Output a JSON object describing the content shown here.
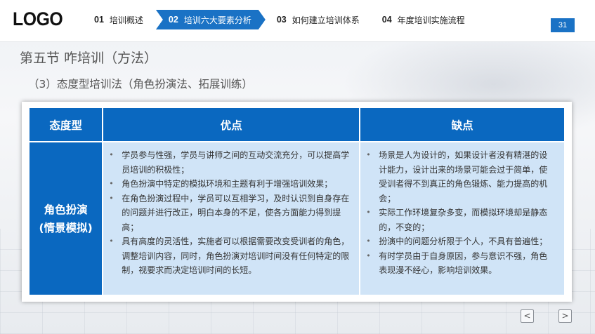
{
  "header": {
    "logo": "LOGO",
    "nav": [
      {
        "num": "01",
        "label": "培训概述"
      },
      {
        "num": "02",
        "label": "培训六大要素分析"
      },
      {
        "num": "03",
        "label": "如何建立培训体系"
      },
      {
        "num": "04",
        "label": "年度培训实施流程"
      }
    ],
    "page_number": "31"
  },
  "title": "第五节  咋培训（方法）",
  "subtitle": "（3）态度型培训法（角色扮演法、拓展训练）",
  "table": {
    "headers": [
      "态度型",
      "优点",
      "缺点"
    ],
    "row": {
      "type_line1": "角色扮演",
      "type_line2": "(情景模拟)",
      "pros": [
        "学员参与性强，学员与讲师之间的互动交流充分，可以提高学员培训的积极性；",
        "角色扮演中特定的模拟环境和主题有利于增强培训效果；",
        "在角色扮演过程中，学员可以互相学习，及时认识到自身存在的问题并进行改正，明白本身的不足，使各方面能力得到提高；",
        "具有高度的灵活性，实施者可以根据需要改变受训者的角色，调整培训内容，同时，角色扮演对培训时间没有任何特定的限制，视要求而决定培训时间的长短。"
      ],
      "cons": [
        "场景是人为设计的，如果设计者没有精湛的设计能力，设计出来的场景可能会过于简单，使受训者得不到真正的角色锻炼、能力提高的机会；",
        "实际工作环境复杂多变，而模拟环境却是静态的，不变的；",
        "扮演中的问题分析限于个人，不具有普遍性；",
        "有时学员由于自身原因，参与意识不强，角色表现漫不经心，影响培训效果。"
      ]
    }
  },
  "controls": {
    "prev_icon": "<",
    "next_icon": ">"
  },
  "colors": {
    "accent": "#1a72c5",
    "table_header": "#0a68c0",
    "cell_bg": "#d0e4f7"
  }
}
